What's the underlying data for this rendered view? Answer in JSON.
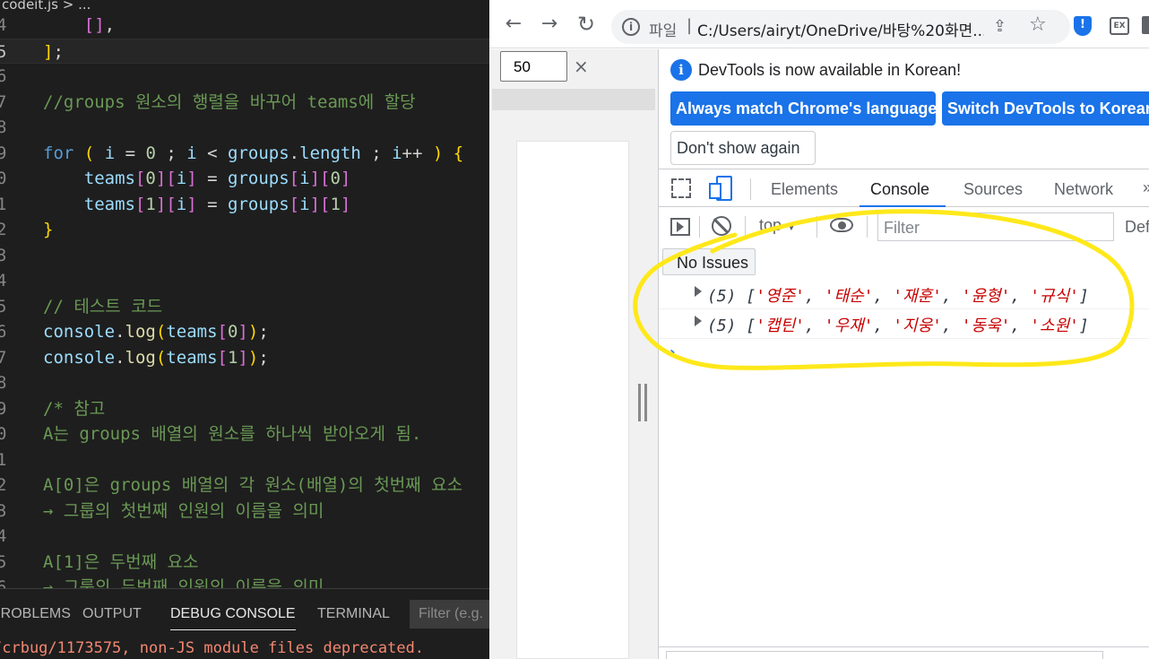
{
  "editor": {
    "breadcrumb": "codeit.js > ...",
    "lines": [
      {
        "n": "4",
        "tokens": [
          [
            "c-plain",
            "    "
          ],
          [
            "c-b2",
            "[]"
          ],
          [
            "c-plain",
            ","
          ]
        ]
      },
      {
        "n": "5",
        "cur": true,
        "active": true,
        "tokens": [
          [
            "c-b1",
            "]"
          ],
          [
            "c-plain",
            ";"
          ]
        ]
      },
      {
        "n": "6",
        "tokens": []
      },
      {
        "n": "7",
        "tokens": [
          [
            "c-cm",
            "//groups 원소의 행렬을 바꾸어 teams에 할당"
          ]
        ]
      },
      {
        "n": "8",
        "tokens": []
      },
      {
        "n": "9",
        "tokens": [
          [
            "c-kw",
            "for"
          ],
          [
            "c-plain",
            " "
          ],
          [
            "c-b1",
            "("
          ],
          [
            "c-plain",
            " "
          ],
          [
            "c-var",
            "i"
          ],
          [
            "c-plain",
            " = "
          ],
          [
            "c-num",
            "0"
          ],
          [
            "c-plain",
            " ; "
          ],
          [
            "c-var",
            "i"
          ],
          [
            "c-plain",
            " < "
          ],
          [
            "c-var",
            "groups"
          ],
          [
            "c-plain",
            "."
          ],
          [
            "c-var",
            "length"
          ],
          [
            "c-plain",
            " ; "
          ],
          [
            "c-var",
            "i"
          ],
          [
            "c-plain",
            "++ "
          ],
          [
            "c-b1",
            ")"
          ],
          [
            "c-plain",
            " "
          ],
          [
            "c-b1",
            "{"
          ]
        ]
      },
      {
        "n": "0",
        "tokens": [
          [
            "c-plain",
            "    "
          ],
          [
            "c-var",
            "teams"
          ],
          [
            "c-b2",
            "["
          ],
          [
            "c-num",
            "0"
          ],
          [
            "c-b2",
            "]"
          ],
          [
            "c-b2",
            "["
          ],
          [
            "c-var",
            "i"
          ],
          [
            "c-b2",
            "]"
          ],
          [
            "c-plain",
            " = "
          ],
          [
            "c-var",
            "groups"
          ],
          [
            "c-b2",
            "["
          ],
          [
            "c-var",
            "i"
          ],
          [
            "c-b2",
            "]"
          ],
          [
            "c-b2",
            "["
          ],
          [
            "c-num",
            "0"
          ],
          [
            "c-b2",
            "]"
          ]
        ]
      },
      {
        "n": "1",
        "tokens": [
          [
            "c-plain",
            "    "
          ],
          [
            "c-var",
            "teams"
          ],
          [
            "c-b2",
            "["
          ],
          [
            "c-num",
            "1"
          ],
          [
            "c-b2",
            "]"
          ],
          [
            "c-b2",
            "["
          ],
          [
            "c-var",
            "i"
          ],
          [
            "c-b2",
            "]"
          ],
          [
            "c-plain",
            " = "
          ],
          [
            "c-var",
            "groups"
          ],
          [
            "c-b2",
            "["
          ],
          [
            "c-var",
            "i"
          ],
          [
            "c-b2",
            "]"
          ],
          [
            "c-b2",
            "["
          ],
          [
            "c-num",
            "1"
          ],
          [
            "c-b2",
            "]"
          ]
        ]
      },
      {
        "n": "2",
        "tokens": [
          [
            "c-b1",
            "}"
          ]
        ]
      },
      {
        "n": "3",
        "tokens": []
      },
      {
        "n": "4",
        "tokens": []
      },
      {
        "n": "5",
        "tokens": [
          [
            "c-cm",
            "// 테스트 코드"
          ]
        ]
      },
      {
        "n": "6",
        "tokens": [
          [
            "c-var",
            "console"
          ],
          [
            "c-plain",
            "."
          ],
          [
            "c-fn",
            "log"
          ],
          [
            "c-b1",
            "("
          ],
          [
            "c-var",
            "teams"
          ],
          [
            "c-b2",
            "["
          ],
          [
            "c-num",
            "0"
          ],
          [
            "c-b2",
            "]"
          ],
          [
            "c-b1",
            ")"
          ],
          [
            "c-plain",
            ";"
          ]
        ]
      },
      {
        "n": "7",
        "tokens": [
          [
            "c-var",
            "console"
          ],
          [
            "c-plain",
            "."
          ],
          [
            "c-fn",
            "log"
          ],
          [
            "c-b1",
            "("
          ],
          [
            "c-var",
            "teams"
          ],
          [
            "c-b2",
            "["
          ],
          [
            "c-num",
            "1"
          ],
          [
            "c-b2",
            "]"
          ],
          [
            "c-b1",
            ")"
          ],
          [
            "c-plain",
            ";"
          ]
        ]
      },
      {
        "n": "8",
        "tokens": []
      },
      {
        "n": "9",
        "tokens": [
          [
            "c-cm",
            "/* 참고"
          ]
        ]
      },
      {
        "n": "0",
        "tokens": [
          [
            "c-cm",
            "A는 groups 배열의 원소를 하나씩 받아오게 됨."
          ]
        ]
      },
      {
        "n": "1",
        "tokens": []
      },
      {
        "n": "2",
        "tokens": [
          [
            "c-cm",
            "A[0]은 groups 배열의 각 원소(배열)의 첫번째 요소"
          ]
        ]
      },
      {
        "n": "3",
        "tokens": [
          [
            "c-cm",
            "→ 그룹의 첫번째 인원의 이름을 의미"
          ]
        ]
      },
      {
        "n": "4",
        "tokens": []
      },
      {
        "n": "5",
        "tokens": [
          [
            "c-cm",
            "A[1]은 두번째 요소"
          ]
        ]
      },
      {
        "n": "6",
        "tokens": [
          [
            "c-cm",
            "→ 그룹의 두번째 인원의 이름을 의미"
          ]
        ]
      }
    ]
  },
  "panel": {
    "tabs": [
      "PROBLEMS",
      "OUTPUT",
      "DEBUG CONSOLE",
      "TERMINAL"
    ],
    "active_tab": "DEBUG CONSOLE",
    "filter_placeholder": "Filter (e.g.",
    "output_line": "/crbug/1173575, non-JS module files deprecated."
  },
  "browser": {
    "url_scheme": "파일",
    "url": "C:/Users/airyt/OneDrive/바탕%20화면...",
    "ext_shield": "!",
    "ext_ex": "EX",
    "zoom_value": "50",
    "zoom_close": "×"
  },
  "devtools": {
    "info_message": "DevTools is now available in Korean!",
    "btn_match": "Always match Chrome's language",
    "btn_switch": "Switch DevTools to Korean",
    "btn_dont": "Don't show again",
    "tabs": [
      "Elements",
      "Console",
      "Sources",
      "Network"
    ],
    "active_tab": "Console",
    "more_tabs": "»",
    "context": "top",
    "filter_placeholder": "Filter",
    "levels": "Def",
    "no_issues": "No Issues",
    "logs": [
      {
        "len": "(5)",
        "items": [
          "영준",
          "태순",
          "재훈",
          "윤형",
          "규식"
        ]
      },
      {
        "len": "(5)",
        "items": [
          "캡틴",
          "우재",
          "지웅",
          "동욱",
          "소원"
        ]
      }
    ],
    "prompt": "›"
  },
  "colors": {
    "annotation": "#ffe81a",
    "chrome_blue": "#1a73e8",
    "console_string": "#c80000"
  }
}
